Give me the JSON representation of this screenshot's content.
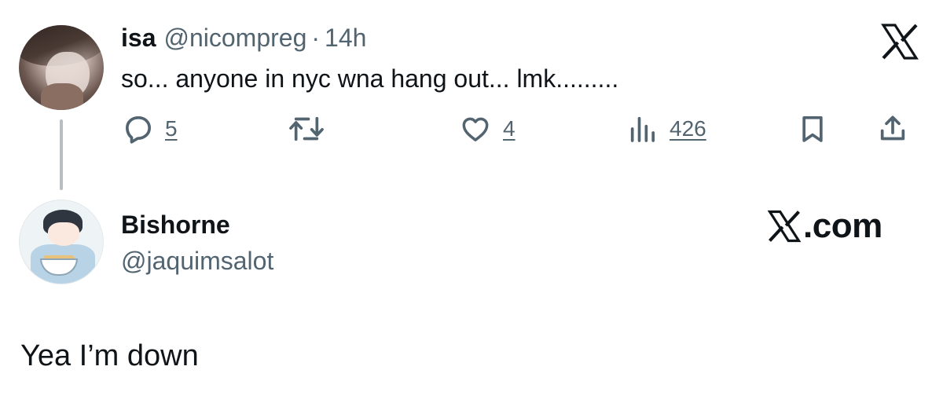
{
  "parent_tweet": {
    "author_name": "isa",
    "author_handle": "@nicompreg",
    "separator": "·",
    "time_ago": "14h",
    "text": "so... anyone in nyc wna hang out... lmk.........",
    "actions": {
      "reply_count": "5",
      "retweet_count": "",
      "like_count": "4",
      "view_count": "426"
    }
  },
  "reply_tweet": {
    "author_name": "Bishorne",
    "author_handle": "@jaquimsalot",
    "text": "Yea I’m down"
  },
  "branding": {
    "xcom_suffix": ".com"
  },
  "icons": {
    "top_logo": "x-logo-icon",
    "reply": "reply-icon",
    "retweet": "retweet-icon",
    "like": "heart-icon",
    "views": "views-icon",
    "bookmark": "bookmark-icon",
    "share": "share-icon"
  },
  "colors": {
    "text_primary": "#0f1419",
    "text_secondary": "#536471",
    "thread_line": "#b9bec3",
    "background": "#ffffff"
  }
}
